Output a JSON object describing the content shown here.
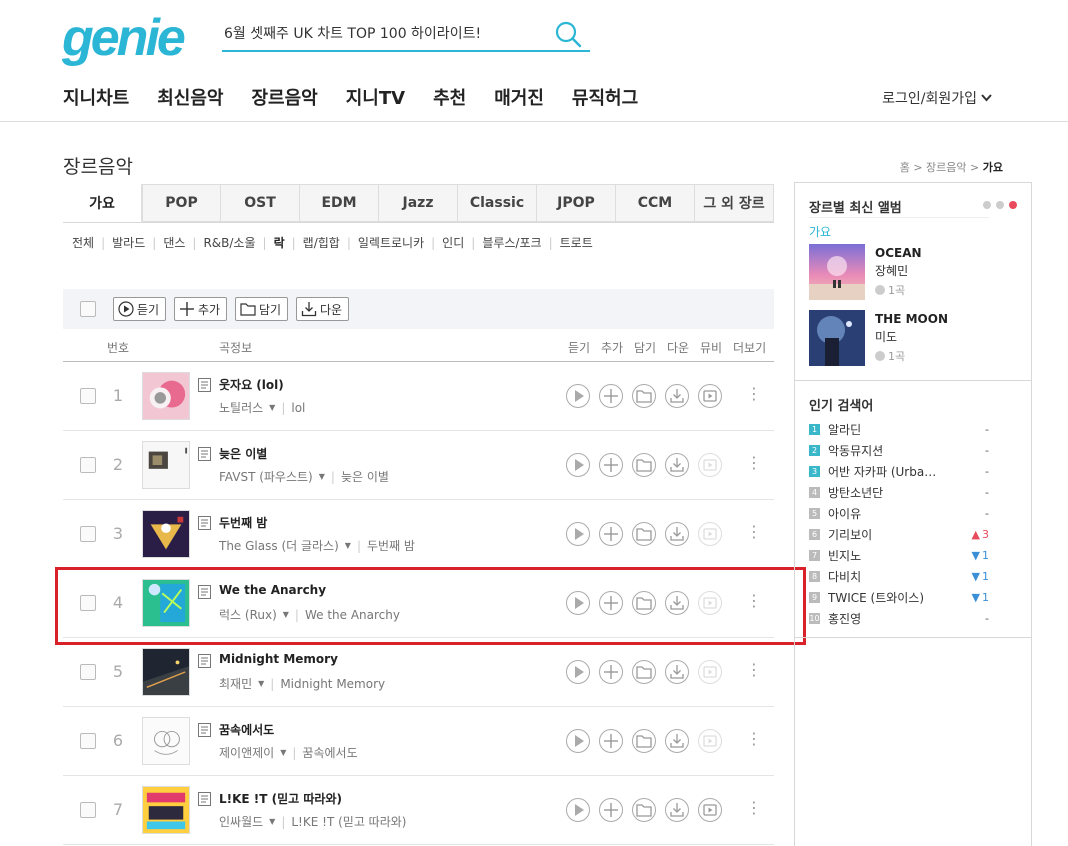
{
  "header": {
    "logo": "genie",
    "search_value": "6월 셋째주 UK 차트 TOP 100 하이라이트!",
    "nav": [
      "지니차트",
      "최신음악",
      "장르음악",
      "지니TV",
      "추천",
      "매거진",
      "뮤직허그"
    ],
    "login": "로그인/회원가입"
  },
  "page": {
    "title": "장르음악",
    "breadcrumb": {
      "home": "홈",
      "parent": "장르음악",
      "current": "가요"
    }
  },
  "tabs": [
    "가요",
    "POP",
    "OST",
    "EDM",
    "Jazz",
    "Classic",
    "JPOP",
    "CCM",
    "그 외 장르"
  ],
  "active_tab": "가요",
  "subgenres": [
    "전체",
    "발라드",
    "댄스",
    "R&B/소울",
    "락",
    "랩/힙합",
    "일렉트로니카",
    "인디",
    "블루스/포크",
    "트로트"
  ],
  "toolbar": {
    "play": "듣기",
    "add": "추가",
    "save": "담기",
    "download": "다운"
  },
  "columns": {
    "num": "번호",
    "info": "곡정보",
    "play": "듣기",
    "add": "추가",
    "save": "담기",
    "download": "다운",
    "mv": "뮤비",
    "more": "더보기"
  },
  "songs": [
    {
      "rank": "1",
      "title": "웃자요 (lol)",
      "artist": "노틸러스",
      "album": "lol",
      "mv": true
    },
    {
      "rank": "2",
      "title": "늦은 이별",
      "artist": "FAVST (파우스트)",
      "album": "늦은 이별",
      "mv": false
    },
    {
      "rank": "3",
      "title": "두번째 밤",
      "artist": "The Glass (더 글라스)",
      "album": "두번째 밤",
      "mv": false
    },
    {
      "rank": "4",
      "title": "We the Anarchy",
      "artist": "럭스 (Rux)",
      "album": "We the Anarchy",
      "mv": false
    },
    {
      "rank": "5",
      "title": "Midnight Memory",
      "artist": "최재민",
      "album": "Midnight Memory",
      "mv": false
    },
    {
      "rank": "6",
      "title": "꿈속에서도",
      "artist": "제이앤제이",
      "album": "꿈속에서도",
      "mv": false
    },
    {
      "rank": "7",
      "title": "L!KE !T (믿고 따라와)",
      "artist": "인싸월드",
      "album": "L!KE !T (믿고 따라와)",
      "mv": true
    }
  ],
  "sidebar": {
    "latest_title": "장르별 최신 앨범",
    "genre": "가요",
    "albums": [
      {
        "title": "OCEAN",
        "artist": "장혜민",
        "count": "1곡"
      },
      {
        "title": "THE MOON",
        "artist": "미도",
        "count": "1곡"
      }
    ],
    "popular_title": "인기 검색어",
    "popular": [
      {
        "rank": "1",
        "name": "알라딘",
        "change": "-",
        "dir": "none"
      },
      {
        "rank": "2",
        "name": "악동뮤지션",
        "change": "-",
        "dir": "none"
      },
      {
        "rank": "3",
        "name": "어반 자카파 (Urba…",
        "change": "-",
        "dir": "none"
      },
      {
        "rank": "4",
        "name": "방탄소년단",
        "change": "-",
        "dir": "none"
      },
      {
        "rank": "5",
        "name": "아이유",
        "change": "-",
        "dir": "none"
      },
      {
        "rank": "6",
        "name": "기리보이",
        "change": "3",
        "dir": "up"
      },
      {
        "rank": "7",
        "name": "빈지노",
        "change": "1",
        "dir": "down"
      },
      {
        "rank": "8",
        "name": "다비치",
        "change": "1",
        "dir": "down"
      },
      {
        "rank": "9",
        "name": "TWICE (트와이스)",
        "change": "1",
        "dir": "down"
      },
      {
        "rank": "10",
        "name": "홍진영",
        "change": "-",
        "dir": "none"
      }
    ]
  },
  "colors": {
    "accent": "#2bb6d6",
    "highlight": "#d9212a"
  }
}
